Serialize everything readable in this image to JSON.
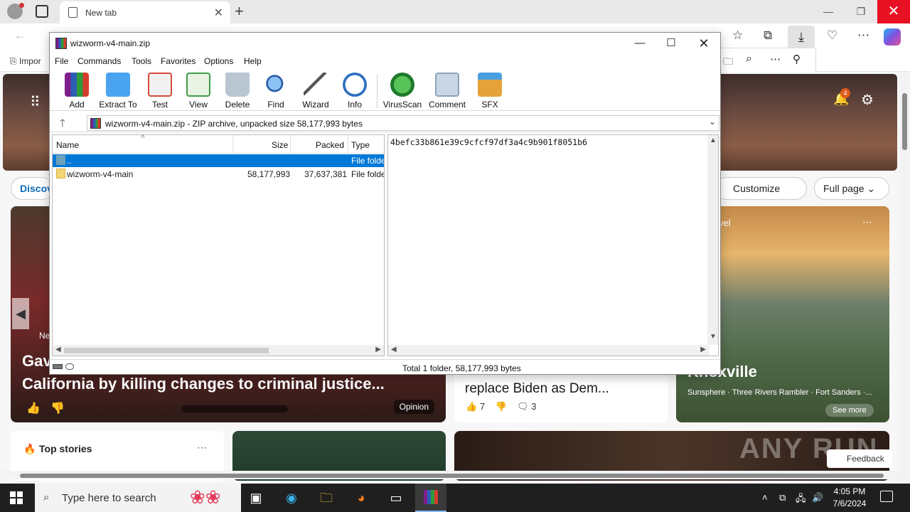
{
  "browser": {
    "tab_title": "New tab",
    "fav_import": "Impor",
    "feed": {
      "discover": "Discov",
      "customize_feed": "Customize feed",
      "full_page": "Full page",
      "notification_count": "4",
      "left_card": {
        "source": "Ne",
        "title_line1": "Gav",
        "title_line2": "California by killing changes to criminal justice...",
        "tag": "Opinion"
      },
      "mid_card": {
        "title_partial": "replace Biden as Dem...",
        "likes": "7",
        "comments": "3"
      },
      "right_card": {
        "label": "vel",
        "title": "Knoxville",
        "subtitle": "Sunsphere · Three Rivers Rambler · Fort Sanders ·...",
        "see_more": "See more"
      },
      "top_stories": "Top stories",
      "feedback": "Feedback",
      "watermark": "ANY RUN"
    }
  },
  "winrar": {
    "title": "wizworm-v4-main.zip",
    "menu": [
      "File",
      "Commands",
      "Tools",
      "Favorites",
      "Options",
      "Help"
    ],
    "toolbar": [
      {
        "label": "Add",
        "icon": "add-icon",
        "color": "#c0392b"
      },
      {
        "label": "Extract To",
        "icon": "extract-icon",
        "color": "#3a8ee6"
      },
      {
        "label": "Test",
        "icon": "test-icon",
        "color": "#d94a3a"
      },
      {
        "label": "View",
        "icon": "view-icon",
        "color": "#3f9b4a"
      },
      {
        "label": "Delete",
        "icon": "delete-icon",
        "color": "#8ea3b5"
      },
      {
        "label": "Find",
        "icon": "find-icon",
        "color": "#3476c7"
      },
      {
        "label": "Wizard",
        "icon": "wizard-icon",
        "color": "#7a9a3a"
      },
      {
        "label": "Info",
        "icon": "info-icon",
        "color": "#2d6fc0"
      },
      {
        "label": "VirusScan",
        "icon": "virusscan-icon",
        "color": "#2ea043"
      },
      {
        "label": "Comment",
        "icon": "comment-icon",
        "color": "#8aa4bd"
      },
      {
        "label": "SFX",
        "icon": "sfx-icon",
        "color": "#d98a2b"
      }
    ],
    "address": "wizworm-v4-main.zip - ZIP archive, unpacked size 58,177,993 bytes",
    "columns": {
      "name": "Name",
      "size": "Size",
      "packed": "Packed",
      "type": "Type"
    },
    "rows": [
      {
        "name": "..",
        "size": "",
        "packed": "",
        "type": "File folde"
      },
      {
        "name": "wizworm-v4-main",
        "size": "58,177,993",
        "packed": "37,637,381",
        "type": "File folde"
      }
    ],
    "comment_hash": "4befc33b861e39c9cfcf97df3a4c9b901f8051b6",
    "status": "Total 1 folder, 58,177,993 bytes"
  },
  "taskbar": {
    "search_placeholder": "Type here to search",
    "time": "4:05 PM",
    "date": "7/6/2024"
  }
}
